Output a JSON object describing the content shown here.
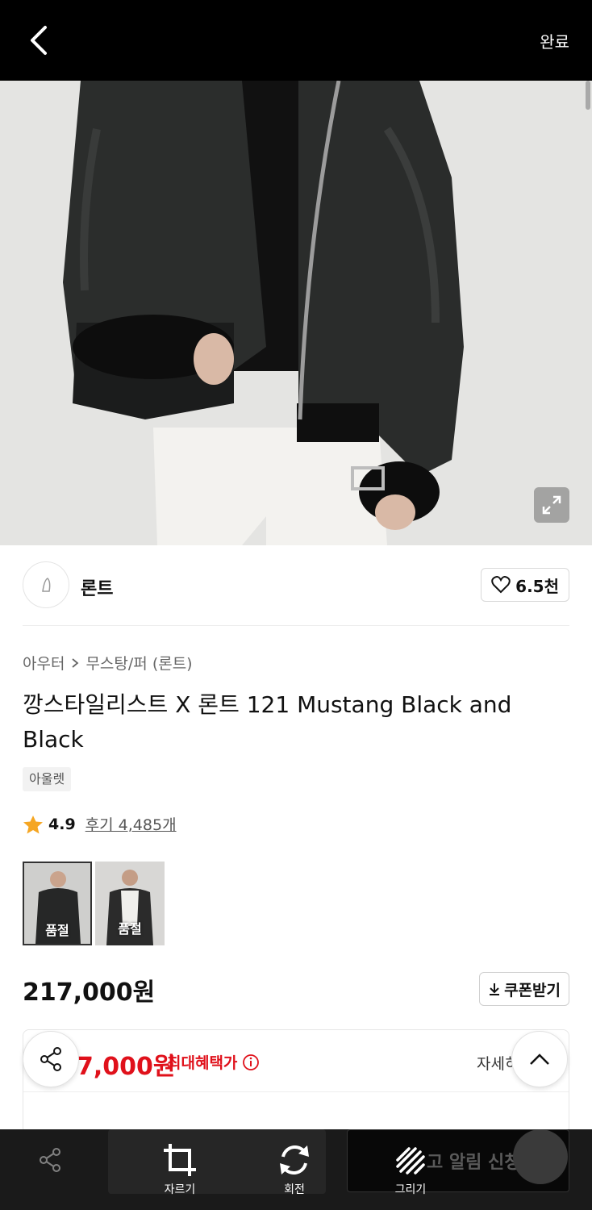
{
  "editor": {
    "done_label": "완료",
    "tools": {
      "crop": "자르기",
      "rotate": "회전",
      "draw": "그리기"
    },
    "background_button_text": "고 알림 신청"
  },
  "product": {
    "brand": "론트",
    "likes": "6.5천",
    "breadcrumb": [
      "아우터",
      "무스탕/퍼 (론트)"
    ],
    "title": "깡스타일리스트 X 론트 121 Mustang Black and Black",
    "tag": "아울렛",
    "rating": "4.9",
    "reviews": "후기 4,485개",
    "thumbnails": [
      {
        "label": "품절",
        "selected": true
      },
      {
        "label": "품절",
        "selected": false
      }
    ],
    "price": "217,000원",
    "coupon_label": "쿠폰받기",
    "benefit_price": "7,000원",
    "benefit_label": "최대혜택가",
    "detail_label": "자세히"
  },
  "colors": {
    "accent_red": "#e0111b",
    "toolbar_bg": "#1a1a1a"
  }
}
